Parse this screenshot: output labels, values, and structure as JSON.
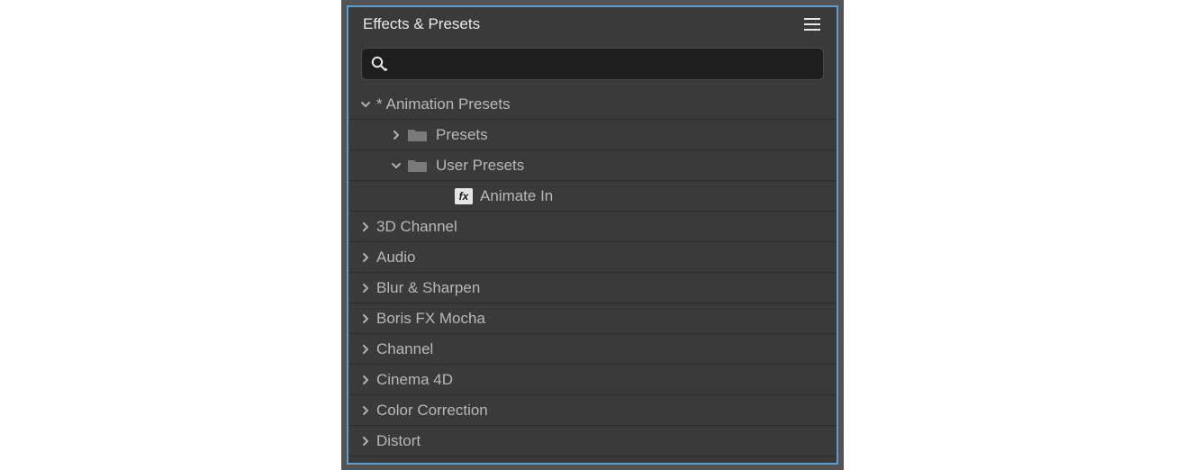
{
  "panel": {
    "title": "Effects & Presets"
  },
  "search": {
    "value": "",
    "placeholder": ""
  },
  "tree": {
    "animation_presets": {
      "prefix": "*",
      "label": "Animation Presets",
      "presets": {
        "label": "Presets"
      },
      "user_presets": {
        "label": "User Presets",
        "animate_in": {
          "label": "Animate In"
        }
      }
    },
    "categories": [
      {
        "label": "3D Channel"
      },
      {
        "label": "Audio"
      },
      {
        "label": "Blur & Sharpen"
      },
      {
        "label": "Boris FX Mocha"
      },
      {
        "label": "Channel"
      },
      {
        "label": "Cinema 4D"
      },
      {
        "label": "Color Correction"
      },
      {
        "label": "Distort"
      }
    ]
  }
}
